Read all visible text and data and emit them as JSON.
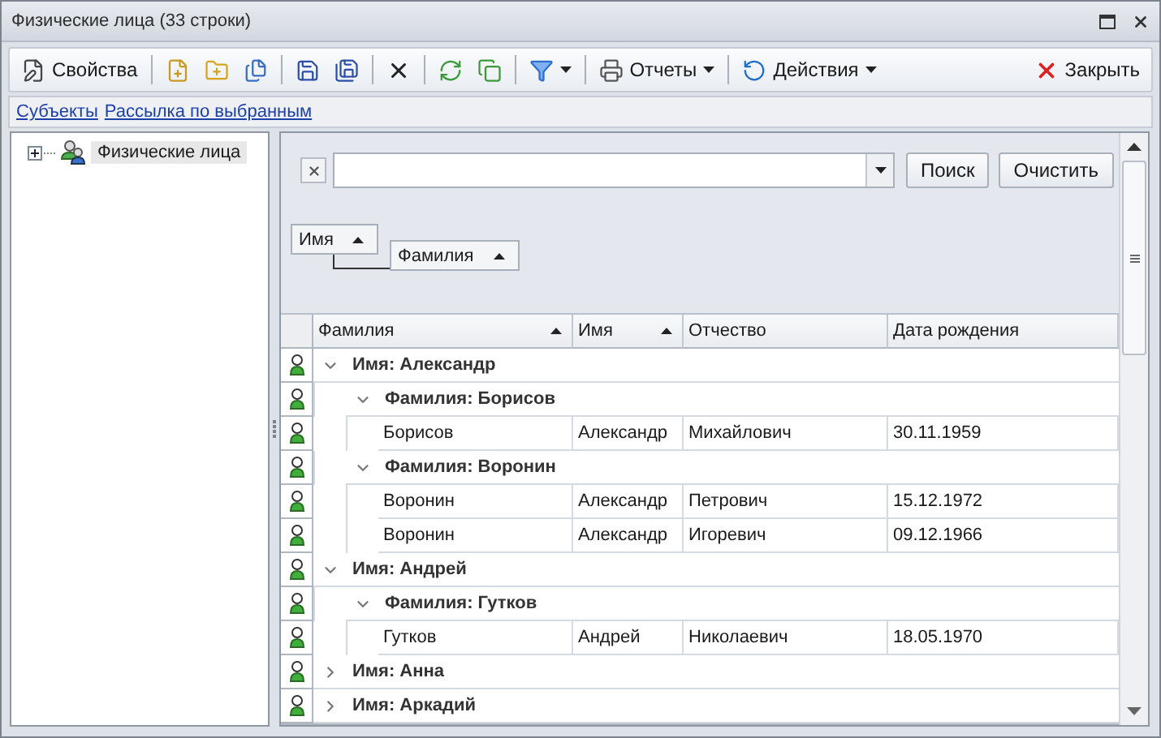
{
  "window": {
    "title": "Физические лица (33 строки)"
  },
  "toolbar": {
    "properties_button": "Свойства",
    "reports_menu": "Отчеты",
    "actions_menu": "Действия",
    "close_button": "Закрыть"
  },
  "links": [
    "Субъекты",
    "Рассылка по выбранным"
  ],
  "tree": [
    {
      "label": "Физические лица",
      "expanded": false,
      "selected": true
    }
  ],
  "search": {
    "search_button": "Поиск",
    "clear_button": "Очистить"
  },
  "group_panel": [
    {
      "label": "Имя",
      "sorted": true
    },
    {
      "label": "Фамилия",
      "sorted": true
    }
  ],
  "table": {
    "columns": [
      {
        "label": "Фамилия",
        "sorted": true
      },
      {
        "label": "Имя",
        "sorted": true
      },
      {
        "label": "Отчество",
        "sorted": false
      },
      {
        "label": "Дата рождения",
        "sorted": false
      }
    ],
    "groups": [
      {
        "label": "Имя: Александр",
        "expanded": true,
        "children": [
          {
            "label": "Фамилия: Борисов",
            "expanded": true,
            "rows": [
              [
                "Борисов",
                "Александр",
                "Михайлович",
                "30.11.1959"
              ]
            ]
          },
          {
            "label": "Фамилия: Воронин",
            "expanded": true,
            "rows": [
              [
                "Воронин",
                "Александр",
                "Петрович",
                "15.12.1972"
              ],
              [
                "Воронин",
                "Александр",
                "Игоревич",
                "09.12.1966"
              ]
            ]
          }
        ]
      },
      {
        "label": "Имя: Андрей",
        "expanded": true,
        "children": [
          {
            "label": "Фамилия: Гутков",
            "expanded": true,
            "rows": [
              [
                "Гутков",
                "Андрей",
                "Николаевич",
                "18.05.1970"
              ]
            ]
          }
        ]
      },
      {
        "label": "Имя: Анна",
        "expanded": false
      },
      {
        "label": "Имя: Аркадий",
        "expanded": false
      }
    ]
  }
}
